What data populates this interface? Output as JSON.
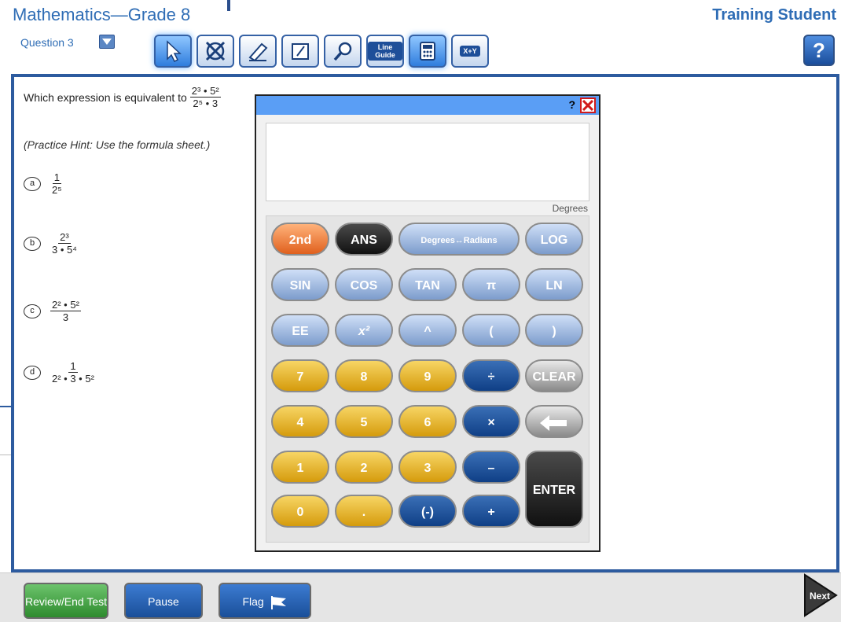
{
  "header": {
    "title": "Mathematics—Grade 8",
    "student": "Training Student",
    "question_label": "Question 3",
    "help_label": "?"
  },
  "toolbar": {
    "line_guide_label": "Line Guide",
    "xy_label": "X+Y"
  },
  "question": {
    "prompt": "Which expression is equivalent to",
    "prompt_frac_num": "2³ • 5²",
    "prompt_frac_den": "2⁵ • 3",
    "hint": "(Practice Hint: Use the formula sheet.)",
    "options": [
      {
        "letter": "a",
        "num": "1",
        "den": "2⁵"
      },
      {
        "letter": "b",
        "num": "2³",
        "den": "3 • 5⁴"
      },
      {
        "letter": "c",
        "num": "2² • 5²",
        "den": "3"
      },
      {
        "letter": "d",
        "num": "1",
        "den": "2² • 3 • 5²"
      }
    ]
  },
  "calculator": {
    "help": "?",
    "mode": "Degrees",
    "keys": {
      "k2nd": "2nd",
      "ans": "ANS",
      "degrad": "Degrees↔Radians",
      "log": "LOG",
      "sin": "SIN",
      "cos": "COS",
      "tan": "TAN",
      "pi": "π",
      "ln": "LN",
      "ee": "EE",
      "x2": "x²",
      "pow": "^",
      "lparen": "(",
      "rparen": ")",
      "d7": "7",
      "d8": "8",
      "d9": "9",
      "div": "÷",
      "clear": "CLEAR",
      "d4": "4",
      "d5": "5",
      "d6": "6",
      "mul": "×",
      "d1": "1",
      "d2": "2",
      "d3": "3",
      "minus": "–",
      "d0": "0",
      "dot": ".",
      "neg": "(-)",
      "plus": "+",
      "enter": "ENTER"
    }
  },
  "footer": {
    "review": "Review/End Test",
    "pause": "Pause",
    "flag": "Flag",
    "next": "Next"
  }
}
